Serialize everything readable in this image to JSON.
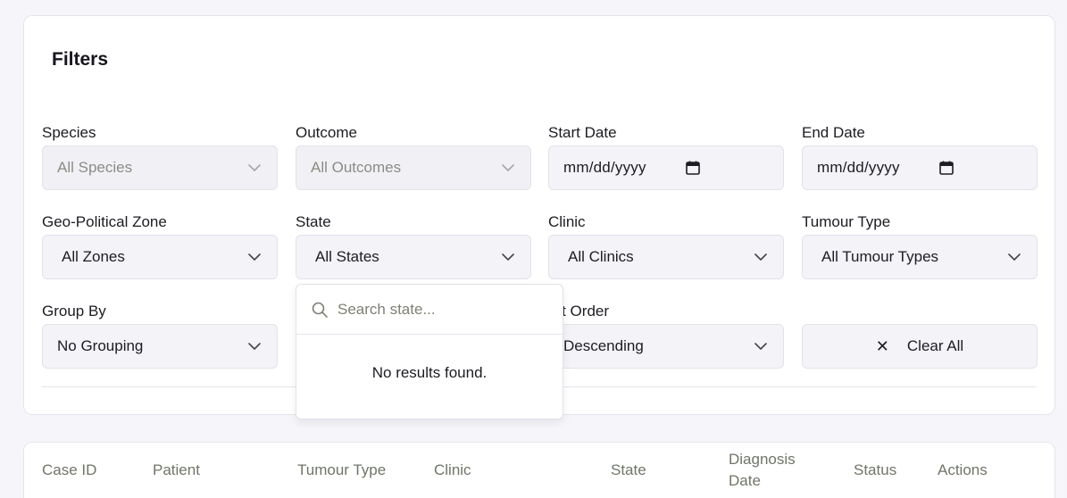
{
  "filters": {
    "title": "Filters",
    "species": {
      "label": "Species",
      "value": "All Species"
    },
    "outcome": {
      "label": "Outcome",
      "value": "All Outcomes"
    },
    "start_date": {
      "label": "Start Date",
      "placeholder": "mm/dd/yyyy"
    },
    "end_date": {
      "label": "End Date",
      "placeholder": "mm/dd/yyyy"
    },
    "zone": {
      "label": "Geo-Political Zone",
      "value": "All Zones"
    },
    "state": {
      "label": "State",
      "value": "All States"
    },
    "clinic": {
      "label": "Clinic",
      "value": "All Clinics"
    },
    "tumour_type": {
      "label": "Tumour Type",
      "value": "All Tumour Types"
    },
    "group_by": {
      "label": "Group By",
      "value": "No Grouping"
    },
    "sort_order": {
      "label": "ort Order",
      "value": "Descending"
    },
    "clear_all_label": "Clear All"
  },
  "state_dropdown": {
    "search_placeholder": "Search state...",
    "empty_message": "No results found."
  },
  "table": {
    "headers": [
      "Case ID",
      "Patient",
      "Tumour Type",
      "Clinic",
      "State",
      "Diagnosis",
      "Date",
      "Status",
      "Actions"
    ]
  },
  "colors": {
    "background": "#f6f5fa",
    "card": "#ffffff",
    "field": "#f4f3f8",
    "muted_text": "#8a8d84",
    "header_text": "#6f7569"
  }
}
